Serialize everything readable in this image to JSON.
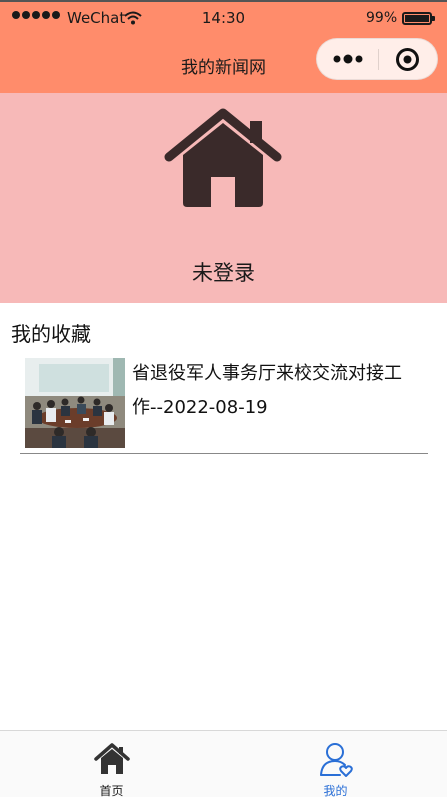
{
  "status_bar": {
    "carrier": "WeChat",
    "time": "14:30",
    "battery": "99%"
  },
  "nav": {
    "title": "我的新闻网"
  },
  "profile": {
    "login_status": "未登录"
  },
  "favorites": {
    "title": "我的收藏",
    "items": [
      {
        "title": "省退役军人事务厅来校交流对接工作--2022-08-19"
      }
    ]
  },
  "tabs": [
    {
      "label": "首页",
      "icon": "home-icon"
    },
    {
      "label": "我的",
      "icon": "user-heart-icon",
      "color": "#2a6fd6"
    }
  ],
  "colors": {
    "header": "#ff8c6b",
    "profile_bg": "#f7b9b8",
    "active_tab": "#2a6fd6"
  }
}
